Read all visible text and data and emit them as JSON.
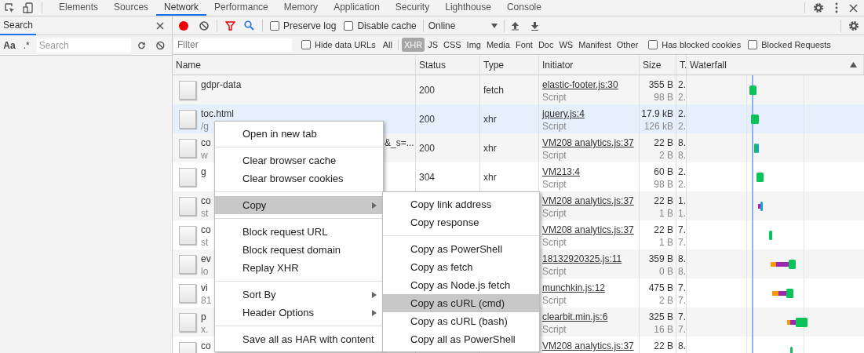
{
  "tabs": [
    {
      "label": "Elements",
      "selected": false
    },
    {
      "label": "Sources",
      "selected": false
    },
    {
      "label": "Network",
      "selected": true
    },
    {
      "label": "Performance",
      "selected": false
    },
    {
      "label": "Memory",
      "selected": false
    },
    {
      "label": "Application",
      "selected": false
    },
    {
      "label": "Security",
      "selected": false
    },
    {
      "label": "Lighthouse",
      "selected": false
    },
    {
      "label": "Console",
      "selected": false
    }
  ],
  "search_panel": {
    "title": "Search",
    "case_toggle": "Aa",
    "regex_toggle": ".*",
    "placeholder": "Search"
  },
  "toolbar": {
    "recording": true,
    "preserve_log": {
      "label": "Preserve log",
      "checked": false
    },
    "disable_cache": {
      "label": "Disable cache",
      "checked": false
    },
    "throttling": "Online"
  },
  "filter_bar": {
    "placeholder": "Filter",
    "hide_data_urls": {
      "label": "Hide data URLs",
      "checked": false
    },
    "types": [
      {
        "label": "All",
        "selected": false
      },
      {
        "label": "XHR",
        "selected": true
      },
      {
        "label": "JS",
        "selected": false
      },
      {
        "label": "CSS",
        "selected": false
      },
      {
        "label": "Img",
        "selected": false
      },
      {
        "label": "Media",
        "selected": false
      },
      {
        "label": "Font",
        "selected": false
      },
      {
        "label": "Doc",
        "selected": false
      },
      {
        "label": "WS",
        "selected": false
      },
      {
        "label": "Manifest",
        "selected": false
      },
      {
        "label": "Other",
        "selected": false
      }
    ],
    "has_blocked_cookies": {
      "label": "Has blocked cookies",
      "checked": false
    },
    "blocked_requests": {
      "label": "Blocked Requests",
      "checked": false
    }
  },
  "table": {
    "columns": [
      "Name",
      "Status",
      "Type",
      "Initiator",
      "Size",
      "T.",
      "Waterfall"
    ],
    "rows": [
      {
        "name": "gdpr-data",
        "status": "200",
        "type": "fetch",
        "initiator": "elastic-footer.js:30",
        "initiator_kind": "Script",
        "size": "355 B",
        "size_2": "98 B",
        "time": "2.",
        "time_2": "2.",
        "selected": false
      },
      {
        "name": "toc.html",
        "path": "/g",
        "status": "200",
        "type": "xhr",
        "initiator": "jquery.js:4",
        "initiator_kind": "Script",
        "size": "17.9 kB",
        "size_2": "126 kB",
        "time": "2.",
        "time_2": "2.",
        "selected": true
      },
      {
        "name": "co",
        "path": "w",
        "name_tail": "&_s=...",
        "status": "200",
        "type": "xhr",
        "initiator": "VM208 analytics.js:37",
        "initiator_kind": "Script",
        "size": "22 B",
        "size_2": "2 B",
        "time": "8.",
        "time_2": "8.",
        "selected": false
      },
      {
        "name": "g",
        "status": "304",
        "type": "xhr",
        "initiator": "VM213:4",
        "initiator_kind": "Script",
        "size": "60 B",
        "size_2": "98 B",
        "time": "2.",
        "time_2": "2.",
        "selected": false
      },
      {
        "name": "co",
        "path": "st",
        "initiator": "VM208 analytics.js:37",
        "initiator_kind": "Script",
        "size": "22 B",
        "size_2": "1 B",
        "time": "1.",
        "time_2": "1.",
        "selected": false
      },
      {
        "name": "co",
        "path": "st",
        "initiator": "VM208 analytics.js:37",
        "initiator_kind": "Script",
        "size": "22 B",
        "size_2": "1 B",
        "time": "7.",
        "time_2": "7.",
        "selected": false
      },
      {
        "name": "ev",
        "path": "lo",
        "initiator": "18132920325.js:11",
        "initiator_kind": "Script",
        "size": "359 B",
        "size_2": "0 B",
        "time": "8.",
        "time_2": "8.",
        "selected": false
      },
      {
        "name": "vi",
        "path": "81",
        "initiator": "munchkin.js:12",
        "initiator_kind": "Script",
        "size": "475 B",
        "size_2": "2 B",
        "time": "7.",
        "time_2": "7.",
        "selected": false
      },
      {
        "name": "p",
        "path": "x.",
        "initiator": "clearbit.min.js:6",
        "initiator_kind": "Script",
        "size": "325 B",
        "size_2": "16 B",
        "time": "7.",
        "time_2": "7.",
        "selected": false
      },
      {
        "name": "co",
        "initiator": "VM208 analytics.js:37",
        "size": "22 B",
        "time": "8.",
        "selected": false
      }
    ]
  },
  "context_menu": {
    "items": [
      {
        "kind": "item",
        "label": "Open in new tab",
        "selected": false,
        "submenu": false
      },
      {
        "kind": "separator"
      },
      {
        "kind": "item",
        "label": "Clear browser cache",
        "selected": false,
        "submenu": false
      },
      {
        "kind": "item",
        "label": "Clear browser cookies",
        "selected": false,
        "submenu": false
      },
      {
        "kind": "separator"
      },
      {
        "kind": "item",
        "label": "Copy",
        "selected": true,
        "submenu": true
      },
      {
        "kind": "separator"
      },
      {
        "kind": "item",
        "label": "Block request URL",
        "selected": false,
        "submenu": false
      },
      {
        "kind": "item",
        "label": "Block request domain",
        "selected": false,
        "submenu": false
      },
      {
        "kind": "item",
        "label": "Replay XHR",
        "selected": false,
        "submenu": false
      },
      {
        "kind": "separator"
      },
      {
        "kind": "item",
        "label": "Sort By",
        "selected": false,
        "submenu": true
      },
      {
        "kind": "item",
        "label": "Header Options",
        "selected": false,
        "submenu": true
      },
      {
        "kind": "separator"
      },
      {
        "kind": "item",
        "label": "Save all as HAR with content",
        "selected": false,
        "submenu": false
      }
    ]
  },
  "copy_submenu": {
    "items": [
      {
        "kind": "item",
        "label": "Copy link address",
        "selected": false,
        "submenu": false
      },
      {
        "kind": "item",
        "label": "Copy response",
        "selected": false,
        "submenu": false
      },
      {
        "kind": "separator"
      },
      {
        "kind": "item",
        "label": "Copy as PowerShell",
        "selected": false,
        "submenu": false
      },
      {
        "kind": "item",
        "label": "Copy as fetch",
        "selected": false,
        "submenu": false
      },
      {
        "kind": "item",
        "label": "Copy as Node.js fetch",
        "selected": false,
        "submenu": false
      },
      {
        "kind": "item",
        "label": "Copy as cURL (cmd)",
        "selected": true,
        "submenu": false
      },
      {
        "kind": "item",
        "label": "Copy as cURL (bash)",
        "selected": false,
        "submenu": false
      },
      {
        "kind": "item",
        "label": "Copy all as PowerShell",
        "selected": false,
        "submenu": false
      }
    ]
  }
}
